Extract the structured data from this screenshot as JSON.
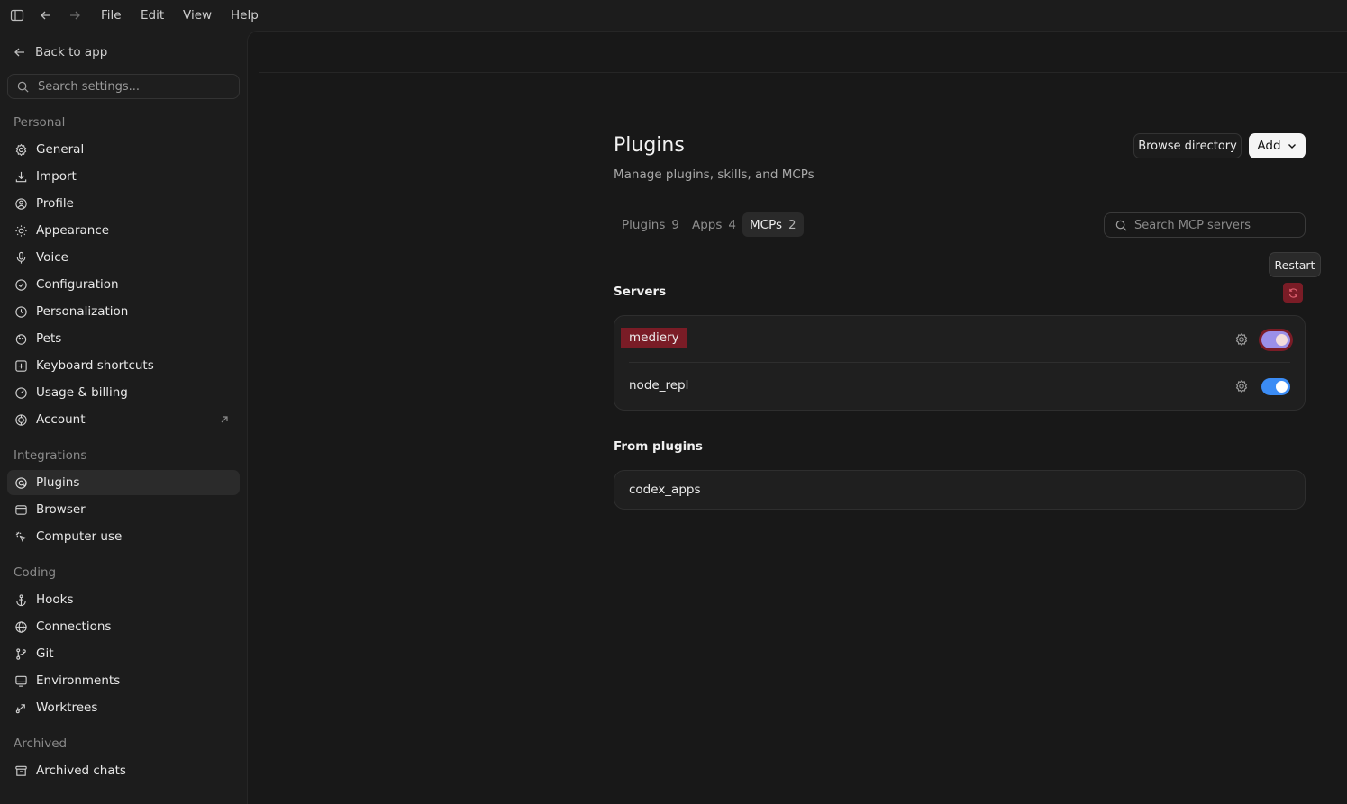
{
  "menubar": {
    "items": [
      "File",
      "Edit",
      "View",
      "Help"
    ]
  },
  "sidebar": {
    "back_label": "Back to app",
    "search_placeholder": "Search settings...",
    "sections": {
      "personal": "Personal",
      "integrations": "Integrations",
      "coding": "Coding",
      "archived": "Archived"
    },
    "items": {
      "general": "General",
      "import": "Import",
      "profile": "Profile",
      "appearance": "Appearance",
      "voice": "Voice",
      "configuration": "Configuration",
      "personalization": "Personalization",
      "pets": "Pets",
      "keyboard_shortcuts": "Keyboard shortcuts",
      "usage_billing": "Usage & billing",
      "account": "Account",
      "plugins": "Plugins",
      "browser": "Browser",
      "computer_use": "Computer use",
      "hooks": "Hooks",
      "connections": "Connections",
      "git": "Git",
      "environments": "Environments",
      "worktrees": "Worktrees",
      "archived_chats": "Archived chats"
    },
    "active_item": "plugins"
  },
  "main": {
    "title": "Plugins",
    "subtitle": "Manage plugins, skills, and MCPs",
    "browse_label": "Browse directory",
    "add_label": "Add",
    "tabs": [
      {
        "label": "Plugins",
        "count": "9"
      },
      {
        "label": "Apps",
        "count": "4"
      },
      {
        "label": "MCPs",
        "count": "2"
      }
    ],
    "active_tab": "MCPs",
    "mcp_search_placeholder": "Search MCP servers",
    "tooltip": "Restart",
    "servers_heading": "Servers",
    "servers": [
      {
        "name": "mediery",
        "enabled": true
      },
      {
        "name": "node_repl",
        "enabled": true
      }
    ],
    "from_plugins_heading": "From plugins",
    "from_plugins": [
      {
        "name": "codex_apps"
      }
    ]
  },
  "colors": {
    "toggle_on": "#3b8cf5",
    "highlight": "#7a1c26",
    "background": "#181818"
  }
}
